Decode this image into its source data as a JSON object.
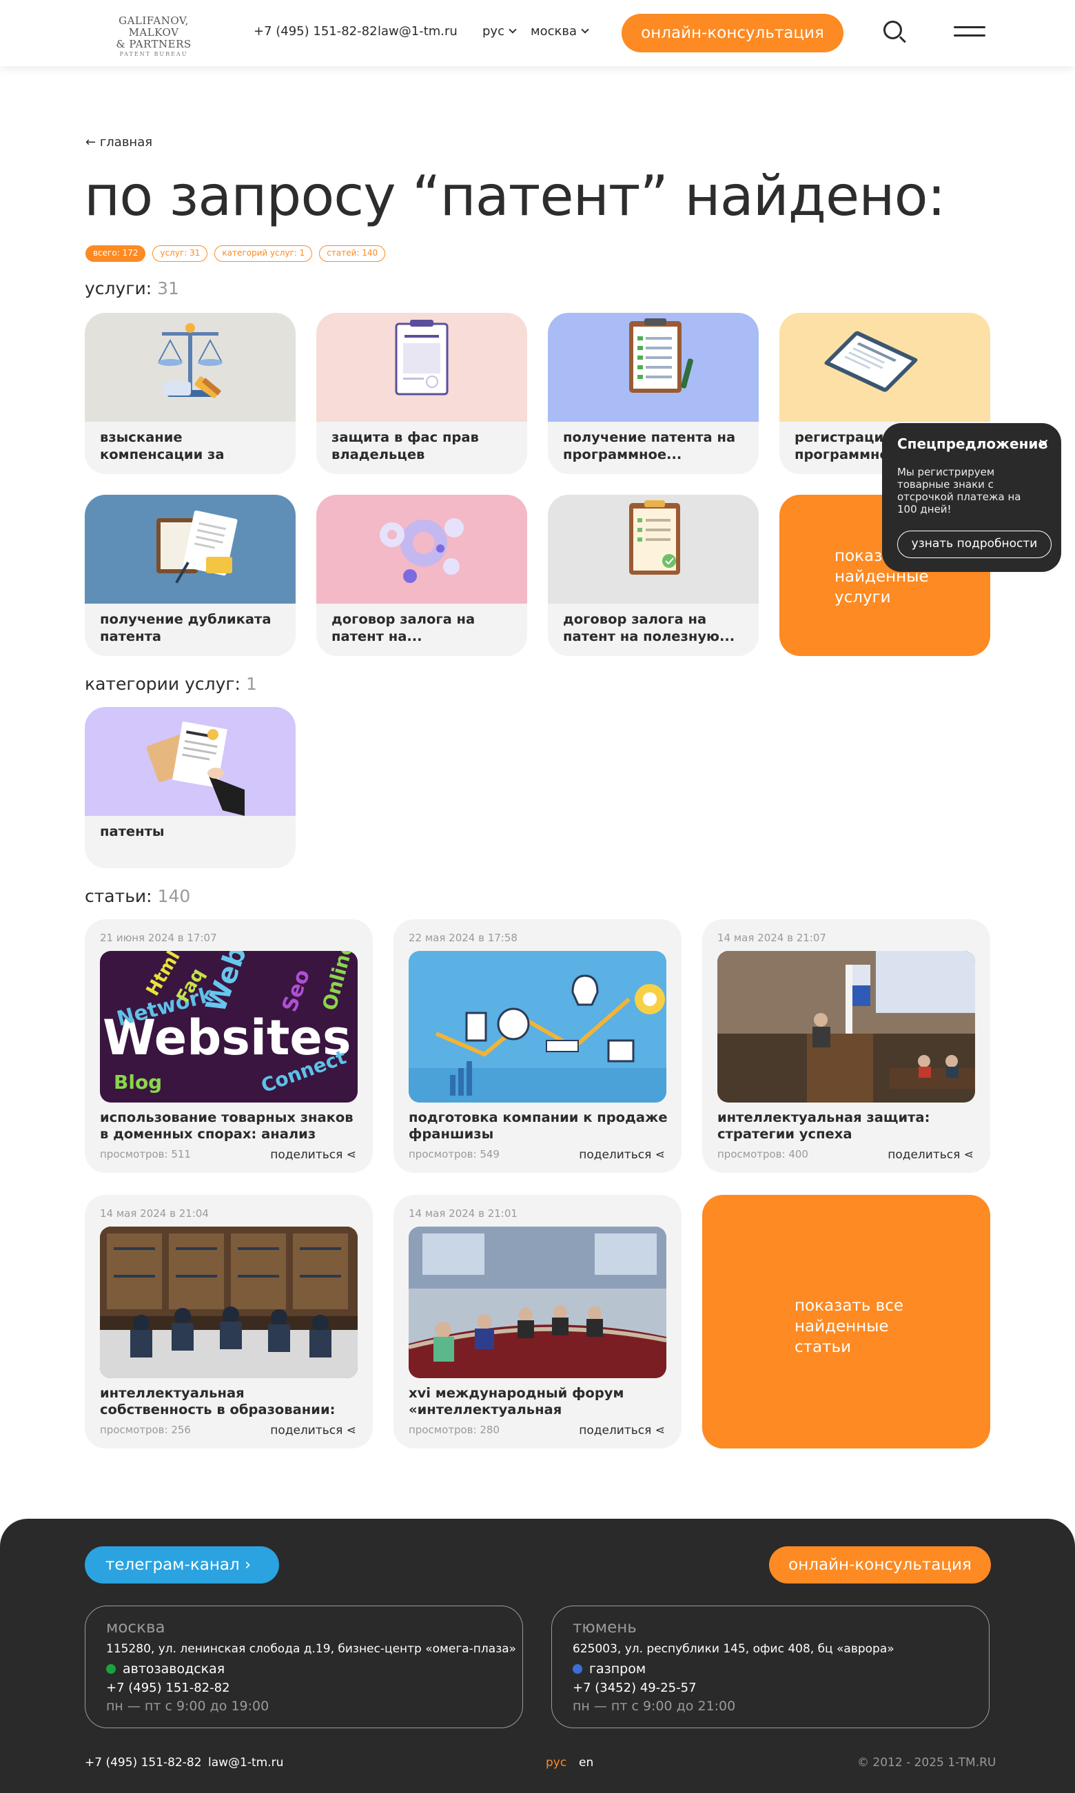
{
  "header": {
    "logo_line1": "GALIFANOV, MALKOV",
    "logo_line2": "& PARTNERS",
    "logo_sub": "PATENT BUREAU",
    "phone": "+7 (495) 151-82-82",
    "email": "law@1-tm.ru",
    "lang": "рус",
    "city": "москва",
    "cta": "онлайн-консультация",
    "search_icon": "search-icon",
    "menu_icon": "hamburger-menu-icon"
  },
  "breadcrumb": {
    "back": "главная"
  },
  "title": "по запросу “патент” найдено:",
  "chips": [
    "всего: 172",
    "услуг: 31",
    "категорий услуг: 1",
    "статей: 140"
  ],
  "services": {
    "heading": "услуги:",
    "count": "31",
    "items": [
      {
        "title": "взыскание компенсации за нарушение патентн...",
        "color": "#e3e1dc"
      },
      {
        "title": "защита в фас прав владельцев товарных...",
        "color": "#f7dcd8"
      },
      {
        "title": "получение патента на программное...",
        "color": "#a9bcf5"
      },
      {
        "title": "регистрация программного...",
        "color": "#fde0a6"
      },
      {
        "title": "получение дубликата патента",
        "color": "#5f8fb7"
      },
      {
        "title": "договор залога на патент на...",
        "color": "#f3b9c7"
      },
      {
        "title": "договор залога на патент на полезную...",
        "color": "#e5e4e4"
      }
    ],
    "show_all": "показать все найденные услуги"
  },
  "promo": {
    "title": "Спецпредложение",
    "text": "Мы регистрируем товарные знаки с отсрочкой платежа на 100 дней!",
    "button": "узнать подробности",
    "close_icon": "close-icon"
  },
  "categories": {
    "heading": "категории услуг:",
    "count": "1",
    "items": [
      {
        "title": "патенты",
        "color": "#d3c6fb"
      }
    ]
  },
  "articles": {
    "heading": "статьи:",
    "count": "140",
    "items": [
      {
        "date": "21 июня 2024 в 17:07",
        "title": "использование товарных знаков в доменных спорах: анализ судебно...",
        "views": "просмотров: 511",
        "share": "поделиться"
      },
      {
        "date": "22 мая 2024 в 17:58",
        "title": "подготовка компании к продаже франшизы",
        "views": "просмотров: 549",
        "share": "поделиться"
      },
      {
        "date": "14 мая 2024 в 21:07",
        "title": "интеллектуальная защита: стратегии успеха",
        "views": "просмотров: 400",
        "share": "поделиться"
      },
      {
        "date": "14 мая 2024 в 21:04",
        "title": "интеллектуальная собственность в образовании: мост к инновациям ...",
        "views": "просмотров: 256",
        "share": "поделиться"
      },
      {
        "date": "14 мая 2024 в 21:01",
        "title": "xvi международный форум «интеллектуальная собственность...",
        "views": "просмотров: 280",
        "share": "поделиться"
      }
    ],
    "show_all": "показать все найденные статьи",
    "image_words": [
      "Websites",
      "Web",
      "Network",
      "Blog",
      "Connect",
      "Html",
      "Faq",
      "Seo",
      "Online"
    ]
  },
  "footer": {
    "telegram": "телеграм-канал",
    "cta": "онлайн-консультация",
    "offices": [
      {
        "city": "москва",
        "address": "115280, ул. ленинская слобода д.19, бизнес-центр «омега-плаза»",
        "metro": "автозаводская",
        "metro_color": "#1aa33b",
        "phone": "+7 (495) 151-82-82",
        "hours": "пн — пт с 9:00 до 19:00"
      },
      {
        "city": "тюмень",
        "address": "625003, ул. республики 145, офис 408, бц «аврора»",
        "metro": "газпром",
        "metro_color": "#3a6fd8",
        "phone": "+7 (3452) 49-25-57",
        "hours": "пн — пт с 9:00 до 21:00"
      }
    ],
    "phone": "+7 (495) 151-82-82",
    "email": "law@1-tm.ru",
    "lang_ru": "рус",
    "lang_en": "en",
    "copyright": "© 2012 - 2025 1-TM.RU"
  },
  "colors": {
    "accent": "#fd8a22",
    "telegram": "#2aa3e0",
    "footer_bg": "#2a2a2a"
  }
}
